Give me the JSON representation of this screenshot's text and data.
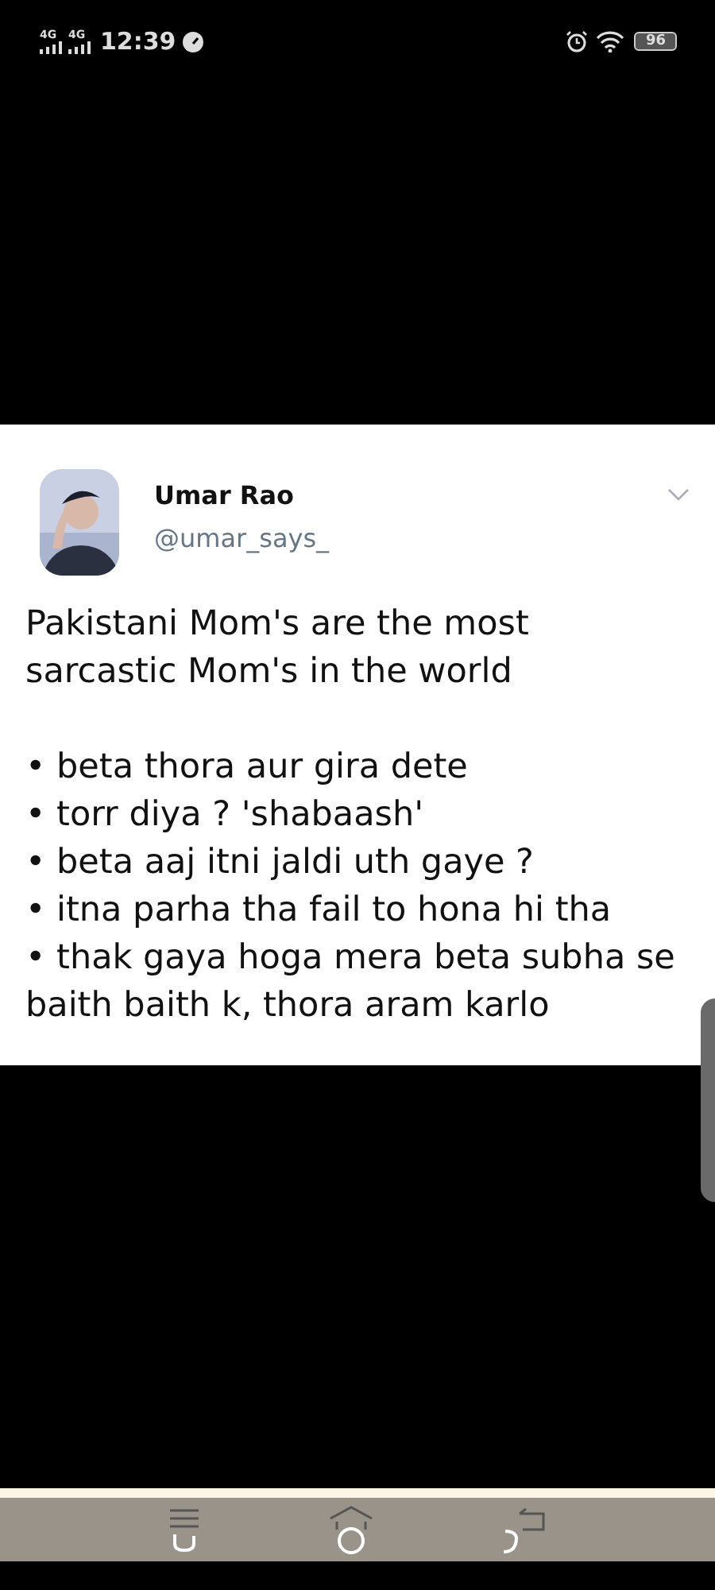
{
  "status_bar": {
    "network_1": "4G",
    "network_2": "4G",
    "time": "12:39",
    "battery": "96"
  },
  "tweet": {
    "name": "Umar Rao",
    "handle": "@umar_says_",
    "intro": "Pakistani Mom's are the most sarcastic Mom's in the world",
    "bullets": [
      "• beta thora aur gira dete",
      "• torr diya ? 'shabaash'",
      "• beta aaj itni jaldi uth gaye ?",
      "• itna parha tha fail to hona hi tha",
      "• thak gaya hoga mera beta subha se baith baith k, thora aram karlo"
    ]
  }
}
